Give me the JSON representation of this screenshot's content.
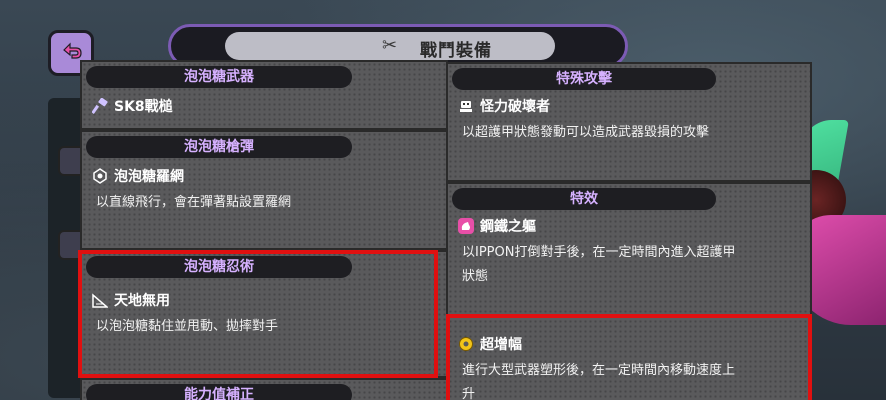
{
  "screen": {
    "title": "戰鬥裝備"
  },
  "weapon": {
    "header": "泡泡糖武器",
    "name": "SK8戰槌",
    "icon": "hammer-icon"
  },
  "bullet": {
    "header": "泡泡糖槍彈",
    "name": "泡泡糖羅網",
    "icon": "web-icon",
    "desc": "以直線飛行，會在彈著點設置羅網"
  },
  "ninjutsu": {
    "header": "泡泡糖忍術",
    "name": "天地無用",
    "icon": "slope-icon",
    "desc": "以泡泡糖黏住並甩動、拋摔對手"
  },
  "stats": {
    "header": "能力值補正"
  },
  "special": {
    "header": "特殊攻擊",
    "name": "怪力破壞者",
    "icon": "robot-icon",
    "desc": "以超護甲狀態發動可以造成武器毀損的攻擊"
  },
  "effects": {
    "header": "特效",
    "items": [
      {
        "name": "鋼鐵之軀",
        "icon": "muscle-icon",
        "desc_line1": "以IPPON打倒對手後，在一定時間內進入超護甲",
        "desc_line2": "狀態"
      },
      {
        "name": "超增幅",
        "icon": "gear-icon",
        "desc_line1": "進行大型武器塑形後，在一定時間內移動速度上",
        "desc_line2": "升"
      }
    ]
  },
  "colors": {
    "header_text": "#d6b1ff",
    "highlight": "#e01010",
    "panel": "#5a5a5c"
  }
}
